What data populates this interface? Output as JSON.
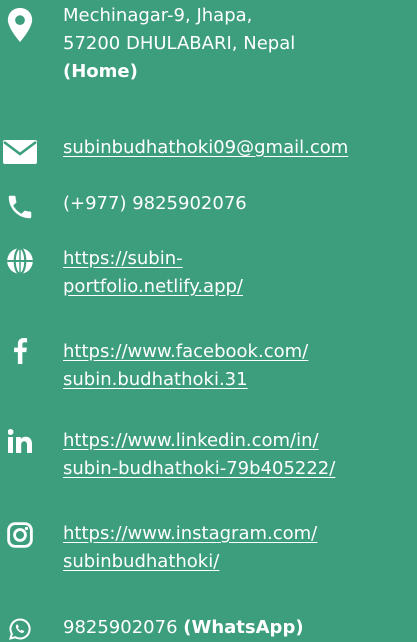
{
  "contacts": {
    "address": {
      "icon": "map-pin-icon",
      "line1": "Mechinagar-9, Jhapa,",
      "line2": "57200 DHULABARI, Nepal",
      "note": "(Home)"
    },
    "email": {
      "icon": "envelope-icon",
      "value": "subinbudhathoki09@gmail.com"
    },
    "phone": {
      "icon": "phone-icon",
      "value": "(+977) 9825902076"
    },
    "website": {
      "icon": "globe-icon",
      "line1": "https://subin-",
      "line2": "portfolio.netlify.app/"
    },
    "facebook": {
      "icon": "facebook-icon",
      "line1": "https://www.facebook.com/",
      "line2": "subin.budhathoki.31"
    },
    "linkedin": {
      "icon": "linkedin-icon",
      "line1": "https://www.linkedin.com/in/",
      "line2": "subin-budhathoki-79b405222/"
    },
    "instagram": {
      "icon": "instagram-icon",
      "line1": "https://www.instagram.com/",
      "line2": "subinbudhathoki/"
    },
    "whatsapp": {
      "icon": "whatsapp-icon",
      "number": "9825902076",
      "note": "(WhatsApp)"
    }
  },
  "colors": {
    "background": "#3d9e7d",
    "text": "#ffffff"
  }
}
